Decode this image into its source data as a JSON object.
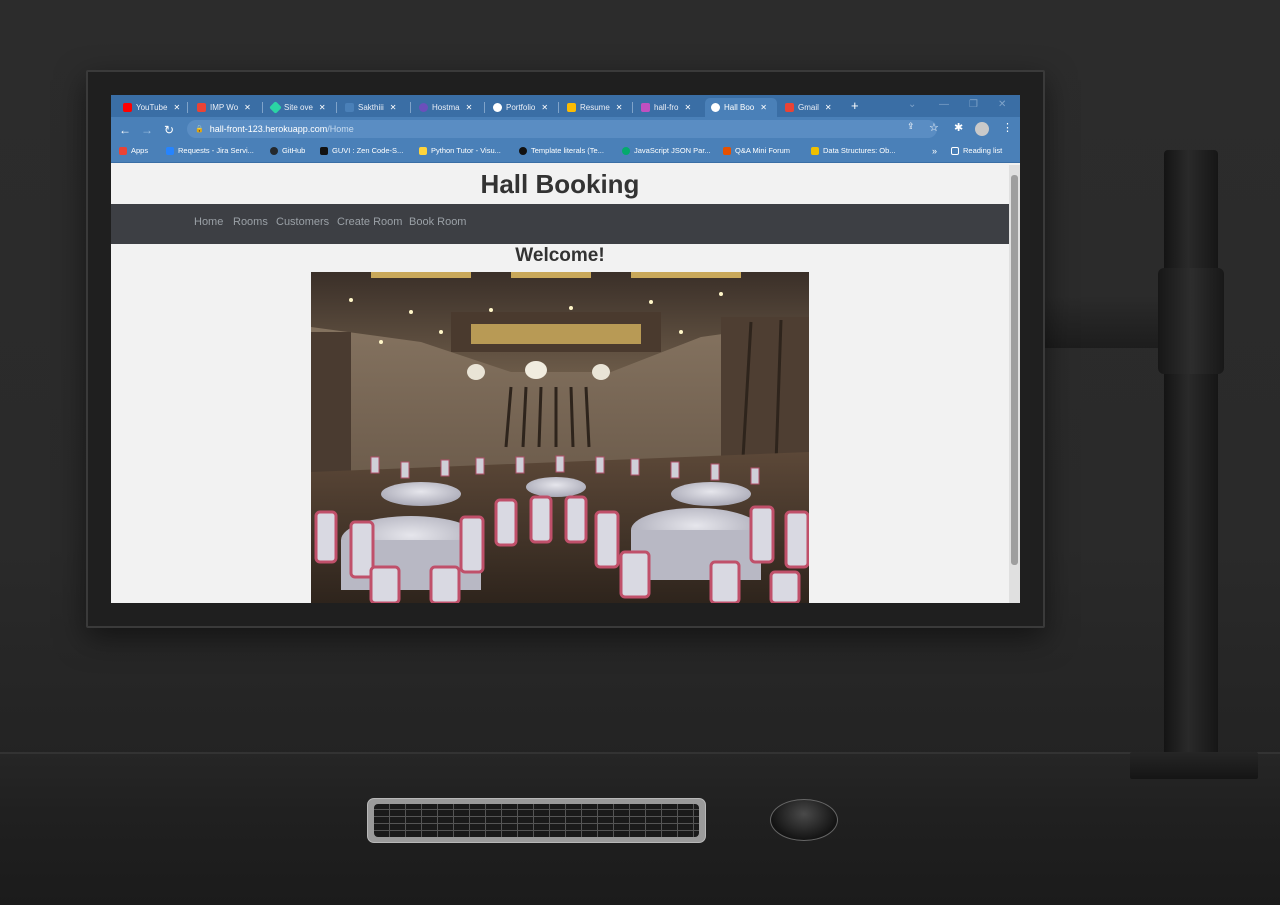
{
  "tabs": [
    {
      "label": "YouTube",
      "color": "#ff0000"
    },
    {
      "label": "IMP Wo",
      "color": "#ea4335"
    },
    {
      "label": "Site ove",
      "color": "#2bd4a4"
    },
    {
      "label": "Sakthiii",
      "color": "#4a80b8"
    },
    {
      "label": "Hostma",
      "color": "#6b4fbb"
    },
    {
      "label": "Portfolio",
      "color": "#ffffff"
    },
    {
      "label": "Resume",
      "color": "#fbbc04"
    },
    {
      "label": "hall-fro",
      "color": "#c050c0"
    },
    {
      "label": "Hall Boo",
      "color": "#ffffff"
    },
    {
      "label": "Gmail",
      "color": "#ea4335"
    }
  ],
  "new_tab": "+",
  "address": {
    "host": "hall-front-123.herokuapp.com",
    "path": "/Home"
  },
  "bookmarks": [
    {
      "label": "Apps",
      "color": "#ea4335"
    },
    {
      "label": "Requests - Jira Servi...",
      "color": "#2684ff"
    },
    {
      "label": "GitHub",
      "color": "#24292e"
    },
    {
      "label": "GUVI : Zen Code-S...",
      "color": "#111111"
    },
    {
      "label": "Python Tutor - Visu...",
      "color": "#ffd43b"
    },
    {
      "label": "Template literals (Te...",
      "color": "#111111"
    },
    {
      "label": "JavaScript JSON Par...",
      "color": "#04aa6d"
    },
    {
      "label": "Q&A Mini Forum",
      "color": "#e65100"
    },
    {
      "label": "Data Structures: Ob...",
      "color": "#f0c000"
    }
  ],
  "bookmarks_overflow": "»",
  "reading_list": "Reading list",
  "site": {
    "title": "Hall Booking",
    "nav": [
      "Home",
      "Rooms",
      "Customers",
      "Create Room",
      "Book Room"
    ],
    "welcome": "Welcome!"
  }
}
